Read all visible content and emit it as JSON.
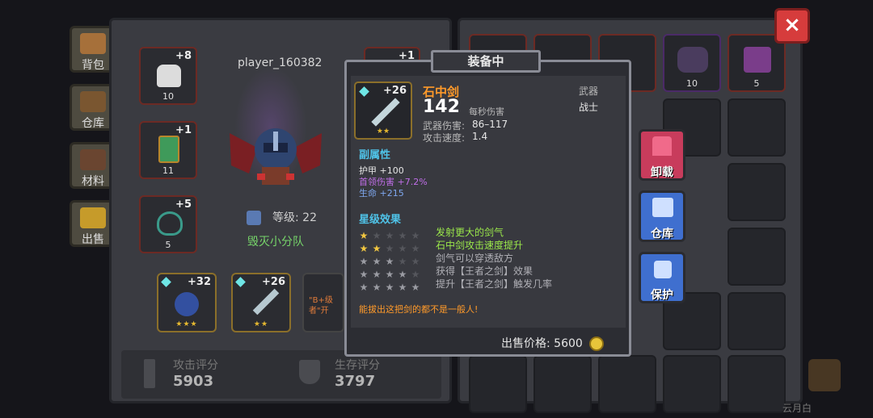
{
  "title": "装备中",
  "close": "×",
  "side_tabs": [
    {
      "label": "背包"
    },
    {
      "label": "仓库"
    },
    {
      "label": "材料"
    },
    {
      "label": "出售"
    }
  ],
  "player": {
    "name": "player_160382",
    "level_label": "等级: 22",
    "team": "毁灭小分队"
  },
  "equip_slots": [
    {
      "plus": "+8",
      "count": "10"
    },
    {
      "plus": "+1",
      "count": "11"
    },
    {
      "plus": "+5",
      "count": "5"
    },
    {
      "plus": "+1",
      "count": ""
    }
  ],
  "weapon_slots": [
    {
      "plus": "+32",
      "stars": "★★★"
    },
    {
      "plus": "+26",
      "stars": "★★"
    },
    {
      "text": "\"B+级 者\"开"
    }
  ],
  "scores": {
    "attack_label": "攻击评分",
    "attack_value": "5903",
    "survive_label": "生存评分",
    "survive_value": "3797"
  },
  "grid_items": [
    {
      "count": "10"
    },
    {
      "count": "5"
    }
  ],
  "tooltip": {
    "weapon_plus": "+26",
    "weapon_stars": "★★",
    "name": "石中剑",
    "dps": "142",
    "dps_label": "每秒伤害",
    "type": "武器",
    "class": "战士",
    "damage_label": "武器伤害:",
    "damage_value": "86–117",
    "speed_label": "攻击速度:",
    "speed_value": "1.4",
    "sub_header": "副属性",
    "sub_stats": [
      {
        "label": "护甲",
        "value": "+100",
        "color": "#e6e6e6"
      },
      {
        "label": "首领伤害",
        "value": "+7.2%",
        "color": "#c06ee8"
      },
      {
        "label": "生命",
        "value": "+215",
        "color": "#7fa8f0"
      }
    ],
    "star_header": "星级效果",
    "star_effects": [
      {
        "stars": 1,
        "text": "发射更大的剑气",
        "active": true
      },
      {
        "stars": 2,
        "text": "石中剑攻击速度提升",
        "active": true
      },
      {
        "stars": 3,
        "text": "剑气可以穿透敌方",
        "active": false
      },
      {
        "stars": 4,
        "text": "获得【王者之剑】效果",
        "active": false
      },
      {
        "stars": 5,
        "text": "提升【王者之剑】触发几率",
        "active": false
      }
    ],
    "flavor": "能拔出这把剑的都不是一般人!",
    "sell_label": "出售价格: 5600"
  },
  "actions": [
    {
      "label": "卸载",
      "color": "#d8476a"
    },
    {
      "label": "仓库",
      "color": "#4a7fd6"
    },
    {
      "label": "保护",
      "color": "#4a7fd6"
    }
  ],
  "corner_text": "云月白",
  "colors": {
    "accent_orange": "#ff9a2a",
    "accent_cyan": "#4fc3e8",
    "accent_green": "#9be84a",
    "accent_yellow": "#f0d040"
  }
}
